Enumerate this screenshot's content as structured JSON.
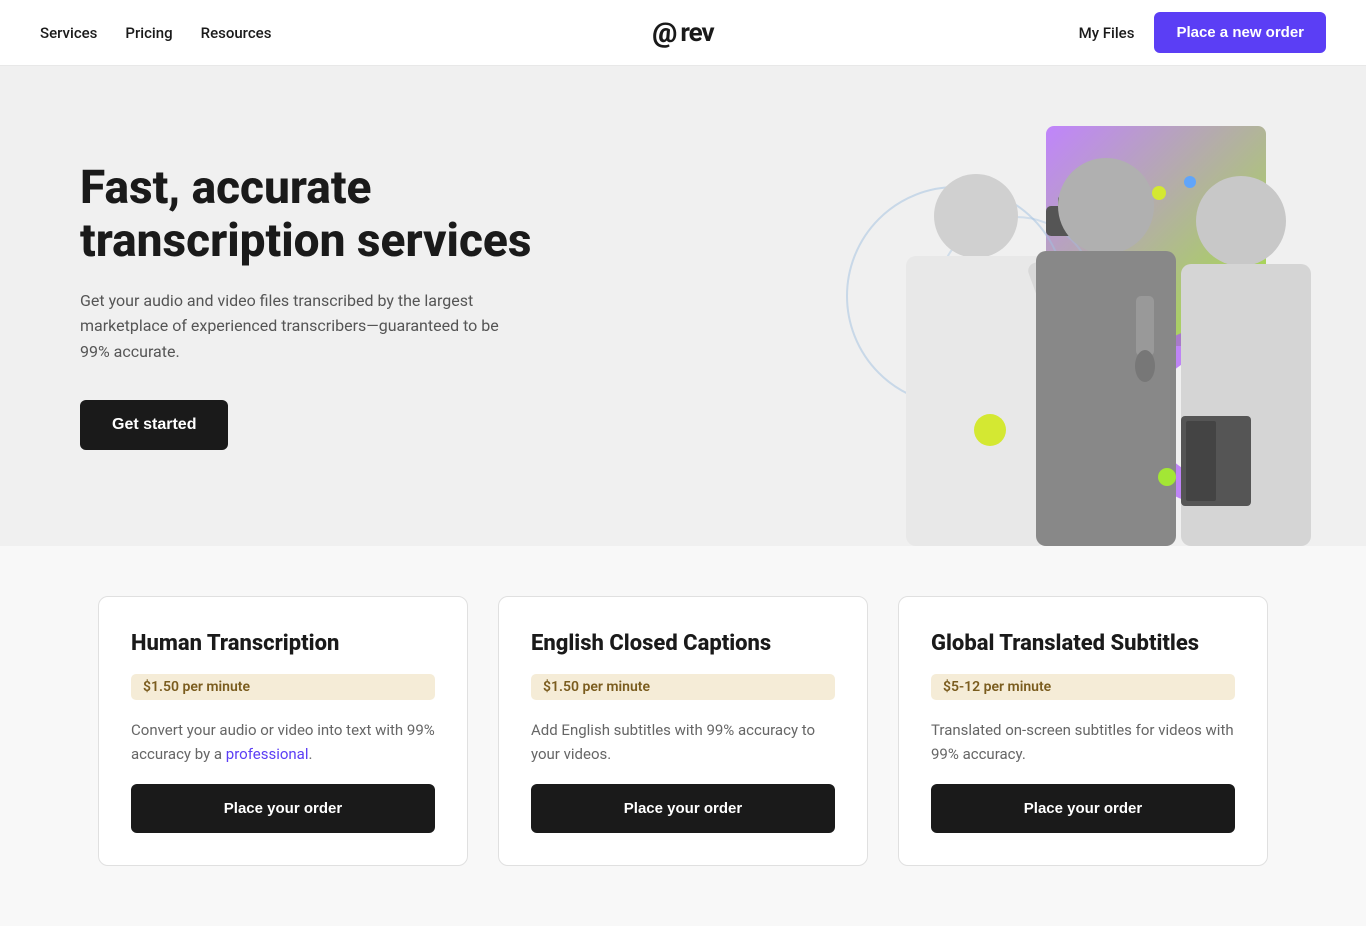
{
  "nav": {
    "logo_at": "@",
    "logo_text": "rev",
    "links": [
      {
        "id": "services",
        "label": "Services"
      },
      {
        "id": "pricing",
        "label": "Pricing"
      },
      {
        "id": "resources",
        "label": "Resources"
      }
    ],
    "my_files": "My Files",
    "cta_label": "Place a new order"
  },
  "hero": {
    "headline": "Fast, accurate transcription services",
    "subtext": "Get your audio and video files transcribed by the largest marketplace of experienced transcribers—guaranteed to be 99% accurate.",
    "cta_label": "Get started"
  },
  "cards": [
    {
      "id": "human-transcription",
      "title": "Human Transcription",
      "price": "$1.50 per minute",
      "description": "Convert your audio or video into text with 99% accuracy by a professional.",
      "cta": "Place your order"
    },
    {
      "id": "english-closed-captions",
      "title": "English Closed Captions",
      "price": "$1.50 per minute",
      "description": "Add English subtitles with 99% accuracy to your videos.",
      "cta": "Place your order"
    },
    {
      "id": "global-translated-subtitles",
      "title": "Global Translated Subtitles",
      "price": "$5-12 per minute",
      "description": "Translated on-screen subtitles for videos with 99% accuracy.",
      "cta": "Place your order"
    }
  ],
  "colors": {
    "primary_purple": "#5b3ef5",
    "dark": "#1a1a1a",
    "price_bg": "#f5ecd7",
    "price_text": "#7a5c1e"
  }
}
